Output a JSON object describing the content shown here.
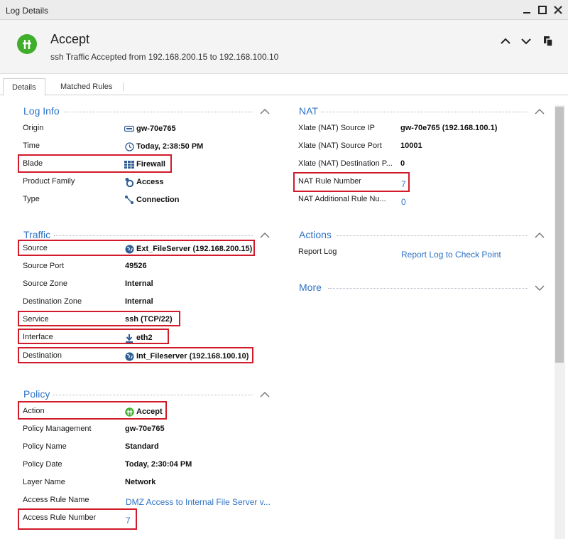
{
  "window": {
    "title": "Log Details"
  },
  "header": {
    "title": "Accept",
    "subtitle": "ssh Traffic Accepted from 192.168.200.15 to 192.168.100.10"
  },
  "tabs": [
    {
      "label": "Details"
    },
    {
      "label": "Matched Rules"
    }
  ],
  "log_info": {
    "title": "Log Info",
    "rows": [
      {
        "label": "Origin",
        "value": "gw-70e765",
        "icon": "gateway-icon"
      },
      {
        "label": "Time",
        "value": "Today, 2:38:50 PM",
        "icon": "clock-icon"
      },
      {
        "label": "Blade",
        "value": "Firewall",
        "icon": "firewall-icon"
      },
      {
        "label": "Product Family",
        "value": "Access",
        "icon": "access-icon"
      },
      {
        "label": "Type",
        "value": "Connection",
        "icon": "connection-icon"
      }
    ]
  },
  "traffic": {
    "title": "Traffic",
    "rows": [
      {
        "label": "Source",
        "value": "Ext_FileServer (192.168.200.15)",
        "icon": "globe-icon"
      },
      {
        "label": "Source Port",
        "value": "49526"
      },
      {
        "label": "Source Zone",
        "value": "Internal"
      },
      {
        "label": "Destination Zone",
        "value": "Internal"
      },
      {
        "label": "Service",
        "value": "ssh (TCP/22)"
      },
      {
        "label": "Interface",
        "value": "eth2",
        "icon": "download-arrow-icon"
      },
      {
        "label": "Destination",
        "value": "Int_Fileserver (192.168.100.10)",
        "icon": "globe-icon"
      }
    ]
  },
  "policy": {
    "title": "Policy",
    "rows": [
      {
        "label": "Action",
        "value": "Accept",
        "icon": "accept-icon"
      },
      {
        "label": "Policy Management",
        "value": "gw-70e765"
      },
      {
        "label": "Policy Name",
        "value": "Standard"
      },
      {
        "label": "Policy Date",
        "value": "Today, 2:30:04 PM"
      },
      {
        "label": "Layer Name",
        "value": "Network"
      },
      {
        "label": "Access Rule Name",
        "value": "DMZ Access to Internal File Server v..."
      },
      {
        "label": "Access Rule Number",
        "value": "7"
      }
    ]
  },
  "nat": {
    "title": "NAT",
    "rows": [
      {
        "label": "Xlate (NAT) Source IP",
        "value": "gw-70e765 (192.168.100.1)"
      },
      {
        "label": "Xlate (NAT) Source Port",
        "value": "10001"
      },
      {
        "label": "Xlate (NAT) Destination P...",
        "value": "0"
      },
      {
        "label": "NAT Rule Number",
        "value": "7"
      },
      {
        "label": "NAT Additional Rule Nu...",
        "value": "0"
      }
    ]
  },
  "actions": {
    "title": "Actions",
    "rows": [
      {
        "label": "Report Log",
        "value": "Report Log to Check Point"
      }
    ]
  },
  "more": {
    "title": "More"
  },
  "colors": {
    "accent": "#2f72c4",
    "accept_green": "#3fae2a",
    "highlight_red": "#d11a2a"
  }
}
